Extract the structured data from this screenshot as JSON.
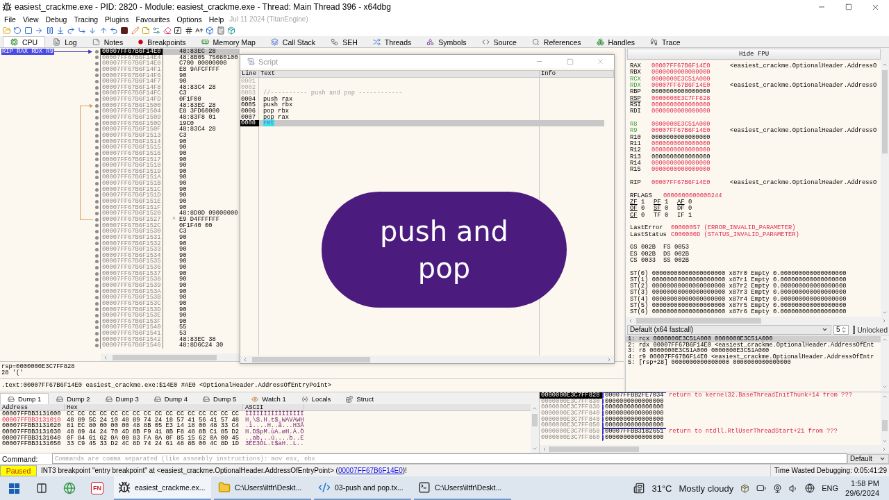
{
  "window": {
    "title": "easiest_crackme.exe - PID: 2820 - Module: easiest_crackme.exe - Thread: Main Thread 396 - x64dbg"
  },
  "menu": {
    "items": [
      "File",
      "View",
      "Debug",
      "Tracing",
      "Plugins",
      "Favourites",
      "Options",
      "Help"
    ],
    "build_info": "Jul 11 2024 (TitanEngine)"
  },
  "tabs": [
    {
      "label": "CPU",
      "selected": true
    },
    {
      "label": "Log",
      "selected": false
    },
    {
      "label": "Notes",
      "selected": false
    },
    {
      "label": "Breakpoints",
      "selected": false
    },
    {
      "label": "Memory Map",
      "selected": false
    },
    {
      "label": "Call Stack",
      "selected": false
    },
    {
      "label": "SEH",
      "selected": false
    },
    {
      "label": "Threads",
      "selected": false
    },
    {
      "label": "Symbols",
      "selected": false
    },
    {
      "label": "Source",
      "selected": false
    },
    {
      "label": "References",
      "selected": false
    },
    {
      "label": "Handles",
      "selected": false
    },
    {
      "label": "Trace",
      "selected": false
    }
  ],
  "disassembly": {
    "rows": [
      {
        "address": "00007FF67B6F14E0",
        "bytes": "48:83EC 28",
        "selected": true,
        "branch_target": false,
        "branch_source": false,
        "register_labels": "RIP RAX RDX R9"
      },
      {
        "address": "00007FF67B6F14E4",
        "bytes": "48:8B05 75080100",
        "selected": false,
        "branch_target": false,
        "branch_source": false
      },
      {
        "address": "00007FF67B6F14E8",
        "bytes": "C700 00000000",
        "selected": false,
        "branch_target": false,
        "branch_source": false
      },
      {
        "address": "00007FF67B6F14F1",
        "bytes": "E8 9AFCFFFF",
        "selected": false,
        "branch_target": false,
        "branch_source": false
      },
      {
        "address": "00007FF67B6F14F6",
        "bytes": "90",
        "selected": false,
        "branch_target": false,
        "branch_source": false
      },
      {
        "address": "00007FF67B6F14F7",
        "bytes": "90",
        "selected": false,
        "branch_target": false,
        "branch_source": false
      },
      {
        "address": "00007FF67B6F14F8",
        "bytes": "48:83C4 28",
        "selected": false,
        "branch_target": false,
        "branch_source": false
      },
      {
        "address": "00007FF67B6F14FC",
        "bytes": "C3",
        "selected": false,
        "branch_target": false,
        "branch_source": false
      },
      {
        "address": "00007FF67B6F14FD",
        "bytes": "0F1F00",
        "selected": false,
        "branch_target": false,
        "branch_source": false
      },
      {
        "address": "00007FF67B6F1500",
        "bytes": "48:83EC 28",
        "selected": false,
        "branch_target": true,
        "branch_source": false
      },
      {
        "address": "00007FF67B6F1504",
        "bytes": "E8 3FD60000",
        "selected": false,
        "branch_target": false,
        "branch_source": false
      },
      {
        "address": "00007FF67B6F1509",
        "bytes": "48:83F8 01",
        "selected": false,
        "branch_target": false,
        "branch_source": false
      },
      {
        "address": "00007FF67B6F150D",
        "bytes": "19C0",
        "selected": false,
        "branch_target": false,
        "branch_source": false
      },
      {
        "address": "00007FF67B6F150F",
        "bytes": "48:83C4 28",
        "selected": false,
        "branch_target": false,
        "branch_source": false
      },
      {
        "address": "00007FF67B6F1513",
        "bytes": "C3",
        "selected": false,
        "branch_target": false,
        "branch_source": false
      },
      {
        "address": "00007FF67B6F1514",
        "bytes": "90",
        "selected": false,
        "branch_target": false,
        "branch_source": false
      },
      {
        "address": "00007FF67B6F1515",
        "bytes": "90",
        "selected": false,
        "branch_target": false,
        "branch_source": false
      },
      {
        "address": "00007FF67B6F1516",
        "bytes": "90",
        "selected": false,
        "branch_target": false,
        "branch_source": false
      },
      {
        "address": "00007FF67B6F1517",
        "bytes": "90",
        "selected": false,
        "branch_target": false,
        "branch_source": false
      },
      {
        "address": "00007FF67B6F1518",
        "bytes": "90",
        "selected": false,
        "branch_target": false,
        "branch_source": false
      },
      {
        "address": "00007FF67B6F1519",
        "bytes": "90",
        "selected": false,
        "branch_target": false,
        "branch_source": false
      },
      {
        "address": "00007FF67B6F151A",
        "bytes": "90",
        "selected": false,
        "branch_target": false,
        "branch_source": false
      },
      {
        "address": "00007FF67B6F151B",
        "bytes": "90",
        "selected": false,
        "branch_target": false,
        "branch_source": false
      },
      {
        "address": "00007FF67B6F151C",
        "bytes": "90",
        "selected": false,
        "branch_target": false,
        "branch_source": false
      },
      {
        "address": "00007FF67B6F151D",
        "bytes": "90",
        "selected": false,
        "branch_target": false,
        "branch_source": false
      },
      {
        "address": "00007FF67B6F151E",
        "bytes": "90",
        "selected": false,
        "branch_target": false,
        "branch_source": false
      },
      {
        "address": "00007FF67B6F151F",
        "bytes": "90",
        "selected": false,
        "branch_target": false,
        "branch_source": false
      },
      {
        "address": "00007FF67B6F1520",
        "bytes": "48:8D0D 09000000",
        "selected": false,
        "branch_target": false,
        "branch_source": false
      },
      {
        "address": "00007FF67B6F1527",
        "bytes": "E9 D4FFFFFF",
        "selected": false,
        "branch_target": false,
        "branch_source": true,
        "mark": "^"
      },
      {
        "address": "00007FF67B6F152C",
        "bytes": "0F1F40 00",
        "selected": false,
        "branch_target": false,
        "branch_source": false
      },
      {
        "address": "00007FF67B6F1530",
        "bytes": "C3",
        "selected": false,
        "branch_target": false,
        "branch_source": false
      },
      {
        "address": "00007FF67B6F1531",
        "bytes": "90",
        "selected": false,
        "branch_target": false,
        "branch_source": false
      },
      {
        "address": "00007FF67B6F1532",
        "bytes": "90",
        "selected": false,
        "branch_target": false,
        "branch_source": false
      },
      {
        "address": "00007FF67B6F1533",
        "bytes": "90",
        "selected": false,
        "branch_target": false,
        "branch_source": false
      },
      {
        "address": "00007FF67B6F1534",
        "bytes": "90",
        "selected": false,
        "branch_target": false,
        "branch_source": false
      },
      {
        "address": "00007FF67B6F1535",
        "bytes": "90",
        "selected": false,
        "branch_target": false,
        "branch_source": false
      },
      {
        "address": "00007FF67B6F1536",
        "bytes": "90",
        "selected": false,
        "branch_target": false,
        "branch_source": false
      },
      {
        "address": "00007FF67B6F1537",
        "bytes": "90",
        "selected": false,
        "branch_target": false,
        "branch_source": false
      },
      {
        "address": "00007FF67B6F1538",
        "bytes": "90",
        "selected": false,
        "branch_target": false,
        "branch_source": false
      },
      {
        "address": "00007FF67B6F1539",
        "bytes": "90",
        "selected": false,
        "branch_target": false,
        "branch_source": false
      },
      {
        "address": "00007FF67B6F153A",
        "bytes": "90",
        "selected": false,
        "branch_target": false,
        "branch_source": false
      },
      {
        "address": "00007FF67B6F153B",
        "bytes": "90",
        "selected": false,
        "branch_target": false,
        "branch_source": false
      },
      {
        "address": "00007FF67B6F153C",
        "bytes": "90",
        "selected": false,
        "branch_target": false,
        "branch_source": false
      },
      {
        "address": "00007FF67B6F153D",
        "bytes": "90",
        "selected": false,
        "branch_target": false,
        "branch_source": false
      },
      {
        "address": "00007FF67B6F153E",
        "bytes": "90",
        "selected": false,
        "branch_target": false,
        "branch_source": false
      },
      {
        "address": "00007FF67B6F153F",
        "bytes": "90",
        "selected": false,
        "branch_target": false,
        "branch_source": false
      },
      {
        "address": "00007FF67B6F1540",
        "bytes": "55",
        "selected": false,
        "branch_target": false,
        "branch_source": false
      },
      {
        "address": "00007FF67B6F1541",
        "bytes": "53",
        "selected": false,
        "branch_target": false,
        "branch_source": false
      },
      {
        "address": "00007FF67B6F1542",
        "bytes": "48:83EC 38",
        "selected": false,
        "branch_target": false,
        "branch_source": false
      },
      {
        "address": "00007FF67B6F1546",
        "bytes": "48:8D6C24 30",
        "selected": false,
        "branch_target": false,
        "branch_source": false
      }
    ]
  },
  "script_window": {
    "title": "Script",
    "columns": [
      "Line",
      "Text",
      "Info"
    ],
    "lines": [
      {
        "number": "0001",
        "kind": "blank",
        "selected": false
      },
      {
        "number": "0002",
        "kind": "blank",
        "selected": false
      },
      {
        "number": "0003",
        "kind": "comment",
        "text": "//---------- push and pop ------------",
        "selected": false
      },
      {
        "number": "0004",
        "kind": "command",
        "text": "push rax",
        "selected": false
      },
      {
        "number": "0005",
        "kind": "command",
        "text": "push rbx",
        "selected": false
      },
      {
        "number": "0006",
        "kind": "command",
        "text": "pop rbx",
        "selected": false
      },
      {
        "number": "0007",
        "kind": "command",
        "text": "pop rax",
        "selected": false
      },
      {
        "number": "0008",
        "kind": "command",
        "text": "ret",
        "selected": true
      }
    ]
  },
  "overlay": {
    "caption": "push and pop"
  },
  "info_pane": {
    "lines": [
      "rsp=0000000E3C7FF828",
      "28 '('"
    ],
    "location": ".text:00007FF67B6F14E0 easiest_crackme.exe:$14E0 #AE0 <OptionalHeader.AddressOfEntryPoint>"
  },
  "registers": {
    "toggle_button": "Hide FPU",
    "groups": [
      [
        {
          "name": "RAX",
          "value": "00007FF67B6F14E0",
          "changed": true,
          "highlighted": false,
          "underlined": false,
          "comment": "<easiest_crackme.OptionalHeader.AddressO"
        },
        {
          "name": "RBX",
          "value": "0000000000000000",
          "changed": true,
          "highlighted": false,
          "underlined": false
        },
        {
          "name": "RCX",
          "value": "0000000E3C51A000",
          "changed": true,
          "highlighted": true,
          "underlined": false
        },
        {
          "name": "RDX",
          "value": "00007FF67B6F14E0",
          "changed": true,
          "highlighted": true,
          "underlined": false,
          "comment": "<easiest_crackme.OptionalHeader.AddressO"
        },
        {
          "name": "RBP",
          "value": "0000000000000000",
          "changed": false,
          "highlighted": false,
          "underlined": false
        },
        {
          "name": "RSP",
          "value": "0000000E3C7FF828",
          "changed": true,
          "highlighted": false,
          "underlined": true
        },
        {
          "name": "RSI",
          "value": "0000000000000000",
          "changed": true,
          "highlighted": false,
          "underlined": false
        },
        {
          "name": "RDI",
          "value": "0000000000000000",
          "changed": true,
          "highlighted": false,
          "underlined": false
        }
      ],
      [
        {
          "name": "R8",
          "value": "0000000E3C51A000",
          "changed": true,
          "highlighted": true,
          "underlined": false
        },
        {
          "name": "R9",
          "value": "00007FF67B6F14E0",
          "changed": true,
          "highlighted": true,
          "underlined": false,
          "comment": "<easiest_crackme.OptionalHeader.AddressO"
        },
        {
          "name": "R10",
          "value": "0000000000000000",
          "changed": false,
          "highlighted": false,
          "underlined": false
        },
        {
          "name": "R11",
          "value": "0000000000000000",
          "changed": true,
          "highlighted": false,
          "underlined": false
        },
        {
          "name": "R12",
          "value": "0000000000000000",
          "changed": true,
          "highlighted": false,
          "underlined": false
        },
        {
          "name": "R13",
          "value": "0000000000000000",
          "changed": false,
          "highlighted": false,
          "underlined": false
        },
        {
          "name": "R14",
          "value": "0000000000000000",
          "changed": true,
          "highlighted": false,
          "underlined": false
        },
        {
          "name": "R15",
          "value": "0000000000000000",
          "changed": true,
          "highlighted": false,
          "underlined": false
        }
      ],
      [
        {
          "name": "RIP",
          "value": "00007FF67B6F14E0",
          "changed": true,
          "highlighted": false,
          "underlined": false,
          "comment": "<easiest_crackme.OptionalHeader.AddressO"
        }
      ]
    ],
    "rflags": {
      "name": "RFLAGS",
      "value": "0000000000000244",
      "changed": true
    },
    "flag_rows": [
      [
        {
          "name": "ZF",
          "value": "1",
          "underlined": true
        },
        {
          "name": "PF",
          "value": "1",
          "underlined": true
        },
        {
          "name": "AF",
          "value": "0",
          "underlined": true
        }
      ],
      [
        {
          "name": "OF",
          "value": "0",
          "underlined": true
        },
        {
          "name": "SF",
          "value": "0",
          "underlined": true
        },
        {
          "name": "DF",
          "value": "0",
          "underlined": false
        }
      ],
      [
        {
          "name": "CF",
          "value": "0",
          "underlined": true
        },
        {
          "name": "TF",
          "value": "0",
          "underlined": false
        },
        {
          "name": "IF",
          "value": "1",
          "underlined": false
        }
      ]
    ],
    "errors": [
      {
        "name": "LastError",
        "value": "00000057 (ERROR_INVALID_PARAMETER)",
        "changed": true
      },
      {
        "name": "LastStatus",
        "value": "C000000D (STATUS_INVALID_PARAMETER)",
        "changed": true
      }
    ],
    "segment_rows": [
      [
        {
          "name": "GS",
          "value": "002B"
        },
        {
          "name": "FS",
          "value": "0053"
        }
      ],
      [
        {
          "name": "ES",
          "value": "002B"
        },
        {
          "name": "DS",
          "value": "002B"
        }
      ],
      [
        {
          "name": "CS",
          "value": "0033"
        },
        {
          "name": "SS",
          "value": "002B"
        }
      ]
    ],
    "fpu": [
      "ST(0) 00000000000000000000 x87r0 Empty 0.000000000000000000",
      "ST(1) 00000000000000000000 x87r1 Empty 0.000000000000000000",
      "ST(2) 00000000000000000000 x87r2 Empty 0.000000000000000000",
      "ST(3) 00000000000000000000 x87r3 Empty 0.000000000000000000",
      "ST(4) 00000000000000000000 x87r4 Empty 0.000000000000000000",
      "ST(5) 00000000000000000000 x87r5 Empty 0.000000000000000000",
      "ST(6) 00000000000000000000 x87r6 Empty 0.000000000000000000"
    ]
  },
  "call_convention": {
    "convention": "Default (x64 fastcall)",
    "count": "5",
    "lock_label": "Unlocked",
    "checked": false
  },
  "arguments": [
    {
      "text": "1: rcx 0000000E3C51A000 0000000E3C51A000",
      "selected": true
    },
    {
      "text": "2: rdx 00007FF67B6F14E0 <easiest_crackme.OptionalHeader.AddressOfEnt",
      "selected": false
    },
    {
      "text": "3: r8 0000000E3C51A000 0000000E3C51A000",
      "selected": false
    },
    {
      "text": "4: r9 00007FF67B6F14E0 <easiest_crackme.OptionalHeader.AddressOfEntr",
      "selected": false
    },
    {
      "text": "5: [rsp+28] 0000000000000000 0000000000000000",
      "selected": false
    }
  ],
  "dump": {
    "tabs": [
      {
        "label": "Dump 1",
        "kind": "dump",
        "selected": true
      },
      {
        "label": "Dump 2",
        "kind": "dump",
        "selected": false
      },
      {
        "label": "Dump 3",
        "kind": "dump",
        "selected": false
      },
      {
        "label": "Dump 4",
        "kind": "dump",
        "selected": false
      },
      {
        "label": "Dump 5",
        "kind": "dump",
        "selected": false
      },
      {
        "label": "Watch 1",
        "kind": "watch",
        "selected": false
      },
      {
        "label": "Locals",
        "kind": "locals",
        "selected": false
      },
      {
        "label": "Struct",
        "kind": "struct",
        "selected": false
      }
    ],
    "columns": [
      "Address",
      "Hex",
      "ASCII"
    ],
    "rows": [
      {
        "address": "00007FFBB3131000",
        "hex": "CC CC CC CC CC CC CC CC CC CC CC CC CC CC CC CC",
        "ascii": "ÌÌÌÌÌÌÌÌÌÌÌÌÌÌÌÌ",
        "changed": false
      },
      {
        "address": "00007FFBB3131010",
        "hex": "48 89 5C 24 10 48 89 74 24 18 57 41 56 41 57 48",
        "ascii": "H.\\$.H.t$.WAVAWH",
        "changed": true
      },
      {
        "address": "00007FFBB3131020",
        "hex": "81 EC 80 00 00 00 48 8B 05 E3 14 18 00 48 33 C4",
        "ascii": ".ì....H..ã...H3Ä",
        "changed": false
      },
      {
        "address": "00007FFBB3131030",
        "hex": "48 89 44 24 70 4D 8B F9 41 8B F8 48 8B C1 85 D2",
        "ascii": "H.D$pM.ùA.øH.Á.Ò",
        "changed": false
      },
      {
        "address": "00007FFBB3131040",
        "hex": "0F 84 61 62 0A 00 83 FA 0A 0F 85 15 62 0A 00 45",
        "ascii": "..ab...ú....b..E",
        "changed": false
      },
      {
        "address": "00007FFBB3131050",
        "hex": "33 C9 45 33 D2 4C 8D 74 24 61 48 8B 00 4C 8D 1D",
        "ascii": "3ÉE3ÒL.t$aH..L..",
        "changed": false
      }
    ]
  },
  "stack": {
    "rows": [
      {
        "address": "0000000E3C7FF828",
        "value": "00007FFBB2FE7034",
        "comment": "return to kernel32.BaseThreadInitThunk+14 from ???",
        "selected": true,
        "frame_start": true,
        "frame_end": false
      },
      {
        "address": "0000000E3C7FF830",
        "value": "0000000000000000",
        "selected": false,
        "frame_start": false,
        "frame_end": false
      },
      {
        "address": "0000000E3C7FF838",
        "value": "0000000000000000",
        "selected": false,
        "frame_start": false,
        "frame_end": false
      },
      {
        "address": "0000000E3C7FF840",
        "value": "0000000000000000",
        "selected": false,
        "frame_start": false,
        "frame_end": false
      },
      {
        "address": "0000000E3C7FF848",
        "value": "0000000000000000",
        "selected": false,
        "frame_start": false,
        "frame_end": false
      },
      {
        "address": "0000000E3C7FF850",
        "value": "0000000000000000",
        "selected": false,
        "frame_start": false,
        "frame_end": true
      },
      {
        "address": "0000000E3C7FF858",
        "value": "00007FFBB3182651",
        "comment": "return to ntdll.RtlUserThreadStart+21 from ???",
        "selected": false,
        "frame_start": true,
        "frame_end": false
      },
      {
        "address": "0000000E3C7FF860",
        "value": "0000000000000000",
        "selected": false,
        "frame_start": false,
        "frame_end": false
      }
    ]
  },
  "command_bar": {
    "label": "Command:",
    "placeholder": "Commands are comma separated (like assembly instructions): mov eax, ebx",
    "mode": "Default"
  },
  "status_bar": {
    "state": "Paused",
    "message_start": "INT3 breakpoint \"entry breakpoint\" at <easiest_crackme.OptionalHeader.AddressOfEntryPoint> (",
    "link": "00007FF67B6F14E0",
    "message_end": ")!",
    "timer": "Time Wasted Debugging: 0:05:41:29"
  },
  "taskbar": {
    "pinned_label": "FN",
    "apps": [
      {
        "label": "easiest_crackme.ex...",
        "kind": "debugger",
        "selected": true
      },
      {
        "label": "C:\\Users\\iltfr\\Deskt...",
        "kind": "folder",
        "selected": false
      },
      {
        "label": "03-push and pop.tx...",
        "kind": "editor",
        "selected": false
      },
      {
        "label": "C:\\Users\\iltfr\\Deskt...",
        "kind": "terminal",
        "selected": false
      }
    ],
    "weather": {
      "temperature": "31°C",
      "condition": "Mostly cloudy"
    },
    "language": "ENG",
    "time": "1:58 PM",
    "date": "29/6/2024"
  }
}
